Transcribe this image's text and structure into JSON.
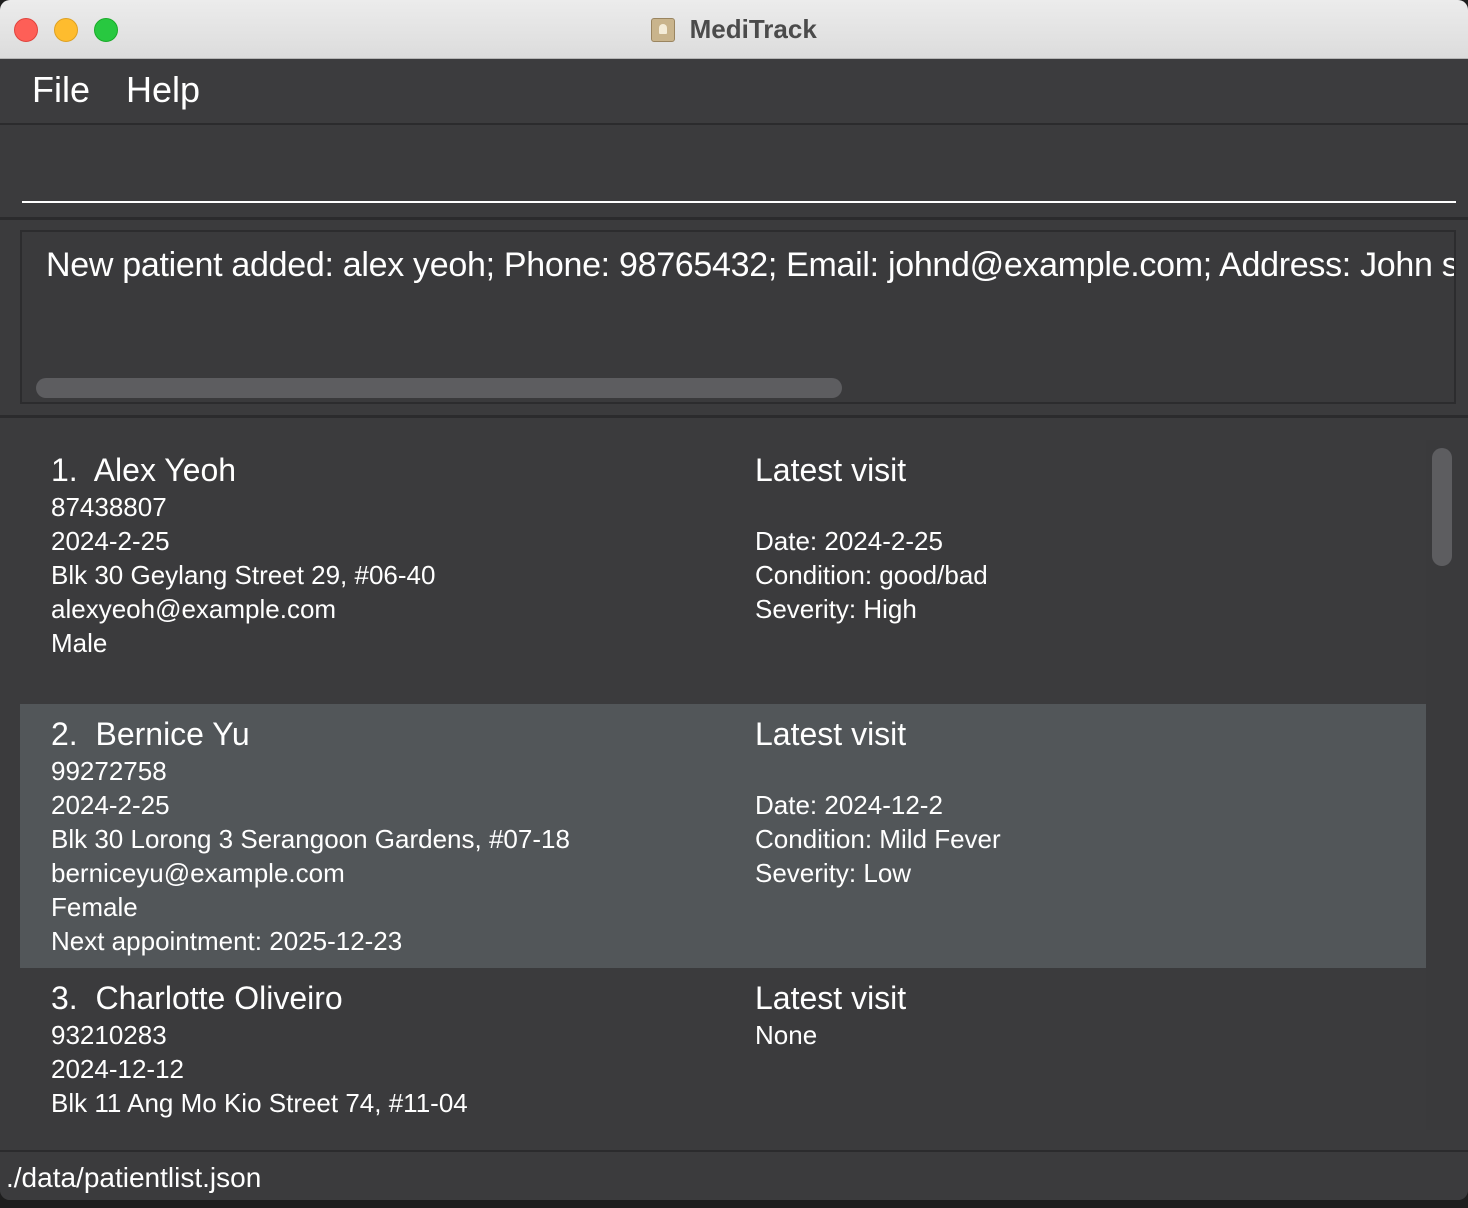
{
  "window": {
    "title": "MediTrack"
  },
  "menu": {
    "file": "File",
    "help": "Help"
  },
  "command": {
    "value": "",
    "placeholder": ""
  },
  "result": {
    "text": "New patient added: alex yeoh; Phone: 98765432; Email: johnd@example.com; Address: John street"
  },
  "patients": [
    {
      "index": "1.",
      "name": "Alex Yeoh",
      "phone": "87438807",
      "date": "2024-2-25",
      "address": "Blk 30 Geylang Street 29, #06-40",
      "email": "alexyeoh@example.com",
      "gender": "Male",
      "latest_visit_label": "Latest visit",
      "visit_date": "Date: 2024-2-25",
      "visit_condition": "Condition: good/bad",
      "visit_severity": "Severity: High"
    },
    {
      "index": "2.",
      "name": "Bernice Yu",
      "phone": "99272758",
      "date": "2024-2-25",
      "address": "Blk 30 Lorong 3 Serangoon Gardens, #07-18",
      "email": "berniceyu@example.com",
      "gender": "Female",
      "appointment": "Next appointment: 2025-12-23",
      "latest_visit_label": "Latest visit",
      "visit_date": "Date: 2024-12-2",
      "visit_condition": "Condition: Mild Fever",
      "visit_severity": "Severity: Low"
    },
    {
      "index": "3.",
      "name": "Charlotte Oliveiro",
      "phone": "93210283",
      "date": "2024-12-12",
      "address": "Blk 11 Ang Mo Kio Street 74, #11-04",
      "latest_visit_label": "Latest visit",
      "visit_none": "None"
    }
  ],
  "status": {
    "path": "./data/patientlist.json"
  },
  "colors": {
    "background": "#3b3b3d",
    "selected_card": "#525659",
    "text": "#ffffff"
  }
}
